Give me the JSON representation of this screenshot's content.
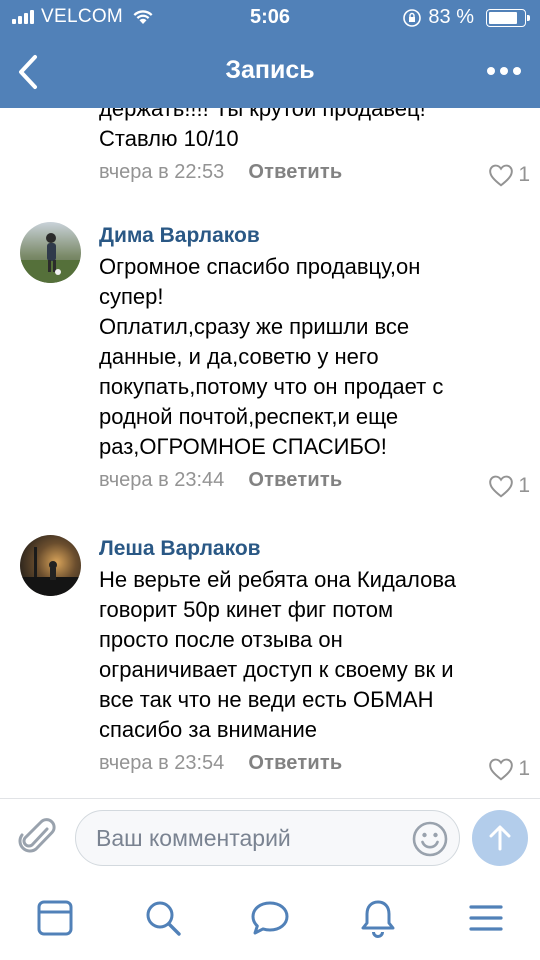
{
  "status_bar": {
    "carrier": "VELCOM",
    "time": "5:06",
    "battery_text": "83 %",
    "battery_level": 0.83
  },
  "nav": {
    "title": "Запись",
    "back_icon": "chevron-left-icon",
    "more_icon": "more-horizontal-icon"
  },
  "comments": [
    {
      "name": "",
      "text_partial_top": "держать!!!! Ты крутой продавец!",
      "text": "Ставлю 10/10",
      "date": "вчера в 22:53",
      "reply_label": "Ответить",
      "likes": "1"
    },
    {
      "name": "Дима Варлаков",
      "text_lines": [
        "Огромное спасибо продавцу,он",
        "супер!",
        "Оплатил,сразу же пришли все",
        "данные, и да,советю у него",
        "покупать,потому что он продает с",
        "родной почтой,респект,и еще",
        "раз,ОГРОМНОЕ СПАСИБО!"
      ],
      "date": "вчера в 23:44",
      "reply_label": "Ответить",
      "likes": "1"
    },
    {
      "name": "Леша Варлаков",
      "text_lines": [
        "Не верьте ей ребята она Кидалова",
        "говорит 50р кинет фиг потом",
        "просто после отзыва он",
        "ограничивает доступ к своему вк и",
        "все так что не веди есть ОБМАН",
        "спасибо за внимание"
      ],
      "date": "вчера в 23:54",
      "reply_label": "Ответить",
      "likes": "1"
    }
  ],
  "composer": {
    "placeholder": "Ваш комментарий",
    "value": ""
  },
  "tabs": [
    {
      "icon": "news-feed-icon"
    },
    {
      "icon": "search-icon"
    },
    {
      "icon": "messages-icon"
    },
    {
      "icon": "notifications-bell-icon"
    },
    {
      "icon": "menu-icon"
    }
  ],
  "colors": {
    "header": "#5181b8",
    "name_link": "#2a5885",
    "meta_gray": "#939393",
    "send_button": "#b3cdeb",
    "tab_icon": "#5181b8"
  }
}
